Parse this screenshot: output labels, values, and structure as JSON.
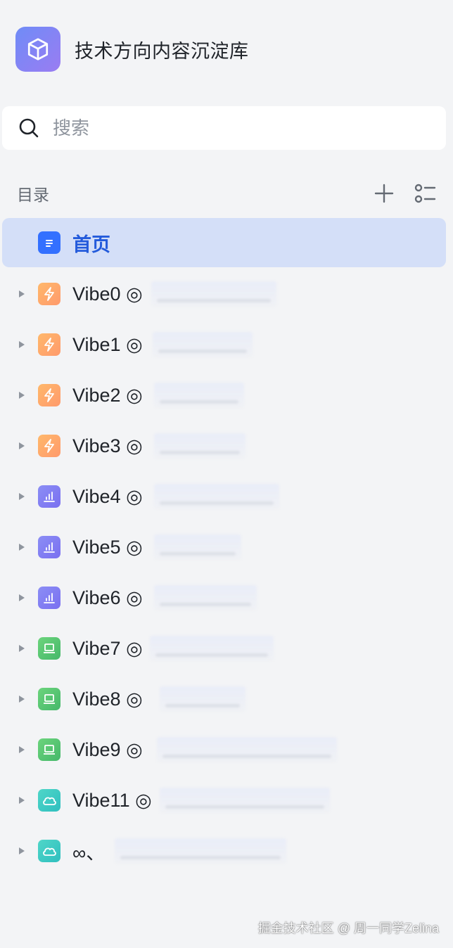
{
  "space": {
    "title": "技术方向内容沉淀库",
    "logo_icon": "cube-icon"
  },
  "search": {
    "placeholder": "搜索"
  },
  "toc": {
    "label": "目录",
    "add_icon": "plus-icon",
    "outline_icon": "list-settings-icon"
  },
  "tree": {
    "selected": {
      "title": "首页",
      "icon": "doc-icon",
      "color": "#245bdb"
    },
    "nodes": [
      {
        "title": "Vibe0 ◎",
        "icon": "lightning-icon",
        "theme": "orange"
      },
      {
        "title": "Vibe1 ◎",
        "icon": "lightning-icon",
        "theme": "orange"
      },
      {
        "title": "Vibe2 ◎",
        "icon": "lightning-icon",
        "theme": "orange"
      },
      {
        "title": "Vibe3 ◎",
        "icon": "lightning-icon",
        "theme": "orange"
      },
      {
        "title": "Vibe4 ◎",
        "icon": "bar-chart-icon",
        "theme": "purple"
      },
      {
        "title": "Vibe5 ◎",
        "icon": "bar-chart-icon",
        "theme": "purple"
      },
      {
        "title": "Vibe6 ◎",
        "icon": "bar-chart-icon",
        "theme": "purple"
      },
      {
        "title": "Vibe7 ◎",
        "icon": "laptop-icon",
        "theme": "green"
      },
      {
        "title": "Vibe8 ◎",
        "icon": "laptop-icon",
        "theme": "green"
      },
      {
        "title": "Vibe9 ◎",
        "icon": "laptop-icon",
        "theme": "green"
      },
      {
        "title": "Vibe11 ◎",
        "icon": "cloud-icon",
        "theme": "teal"
      },
      {
        "title": "∞、",
        "icon": "cloud-icon",
        "theme": "teal"
      }
    ]
  },
  "watermark": {
    "text": "掘金技术社区 @ 周一同学Zelina"
  }
}
